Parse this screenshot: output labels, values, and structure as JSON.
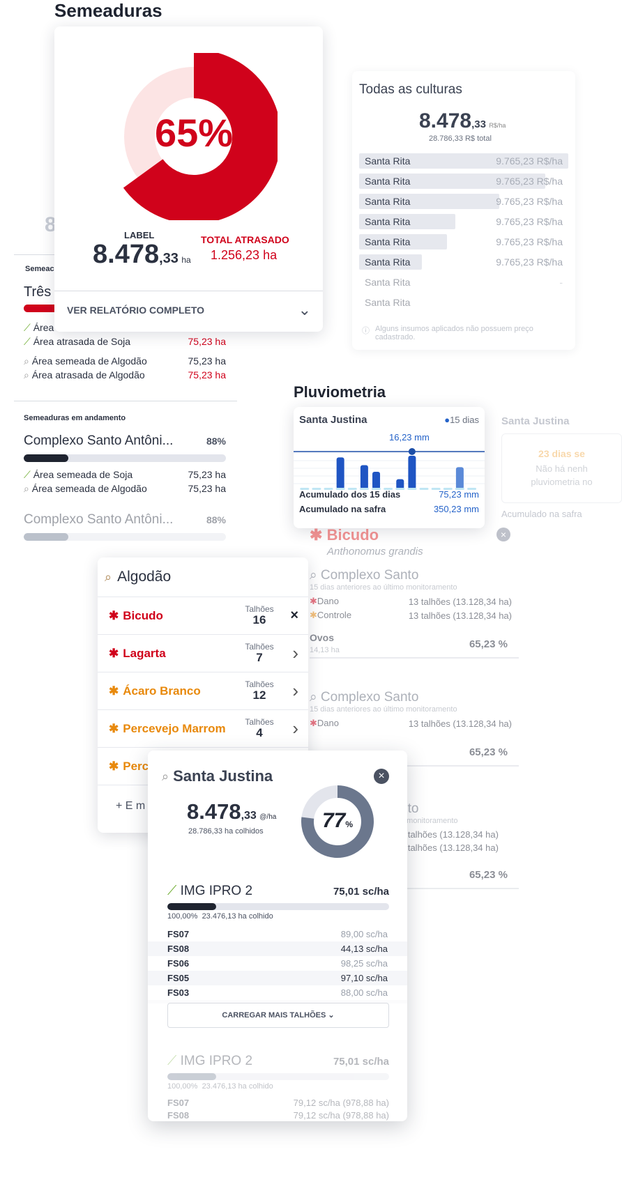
{
  "semeaduras": {
    "title": "Semeaduras",
    "percent": "65%",
    "percent_value": 65,
    "label": "LABEL",
    "value_main": "8.478",
    "value_dec": ",33",
    "value_unit": "ha",
    "atrasado_label": "TOTAL ATRASADO",
    "atrasado_value": "1.256,23 ha",
    "report_link": "VER RELATÓRIO COMPLETO",
    "bg_digit": "8",
    "bg_section": "Semeac",
    "bg_name": "Três",
    "rows": [
      {
        "label": "Área",
        "value": ""
      },
      {
        "label": "Área atrasada de Soja",
        "value": "75,23 ha"
      },
      {
        "label": "Área semeada de Algodão",
        "value": "75,23 ha"
      },
      {
        "label": "Área atrasada de Algodão",
        "value": "75,23 ha"
      }
    ],
    "andamento_title": "Semeaduras em andamento",
    "complex1_name": "Complexo Santo Antôni...",
    "complex1_pct": "88%",
    "complex1_progress": 0.22,
    "complex1_rows": [
      {
        "label": "Área semeada de Soja",
        "value": "75,23 ha"
      },
      {
        "label": "Área semeada de Algodão",
        "value": "75,23 ha"
      }
    ],
    "complex2_name": "Complexo Santo Antôni...",
    "complex2_pct": "88%",
    "complex2_progress": 0.22
  },
  "todas": {
    "title": "Todas as culturas",
    "value_main": "8.478",
    "value_dec": ",33",
    "value_unit": "R$/ha",
    "total": "28.786,33 R$ total",
    "bars": [
      {
        "name": "Santa Rita",
        "value": "9.765,23 R$/ha",
        "fill": 1.0
      },
      {
        "name": "Santa Rita",
        "value": "9.765,23 R$/ha",
        "fill": 0.89
      },
      {
        "name": "Santa Rita",
        "value": "9.765,23 R$/ha",
        "fill": 0.67
      },
      {
        "name": "Santa Rita",
        "value": "9.765,23 R$/ha",
        "fill": 0.46
      },
      {
        "name": "Santa Rita",
        "value": "9.765,23 R$/ha",
        "fill": 0.42
      },
      {
        "name": "Santa Rita",
        "value": "9.765,23 R$/ha",
        "fill": 0.3
      },
      {
        "name": "Santa Rita",
        "value": "-",
        "fill": 0.0
      },
      {
        "name": "Santa Rita",
        "value": "",
        "fill": 0.0
      }
    ],
    "note": "Alguns insumos aplicados não possuem preço cadastrado."
  },
  "pluvio": {
    "title": "Pluviometria",
    "station": "Santa Justina",
    "days": "15 dias",
    "line_label": "16,23 mm",
    "bars": [
      0,
      0,
      0,
      0.95,
      0,
      0.72,
      0.52,
      0,
      0.3,
      1.0,
      0,
      0,
      0,
      0.66,
      0
    ],
    "acum15_label": "Acumulado dos 15 dias",
    "acum15_value": "75,23 mm",
    "safra_label": "Acumulado na safra",
    "safra_value": "350,23 mm",
    "card2_station": "Santa Justina",
    "card2_alert": "23 dias se",
    "card2_text1": "Não há nenh",
    "card2_text2": "pluviometria no",
    "card2_acum": "Acumulado na safra"
  },
  "bicudo": {
    "name": "Bicudo",
    "sci": "Anthonomus grandis",
    "blocks": [
      {
        "title": "Complexo Santo",
        "sub": "15 dias anteriores ao último monitoramento",
        "dano": "Dano",
        "dano_val": "13 talhões (13.128,34 ha)",
        "controle": "Controle",
        "controle_val": "13 talhões (13.128,34 ha)",
        "metric": "Ovos",
        "metric_sub": "14,13 ha",
        "pct": "65,23 %"
      },
      {
        "title": "Complexo Santo",
        "sub": "15 dias anteriores ao último monitoramento",
        "dano": "Dano",
        "dano_val": "13 talhões (13.128,34 ha)",
        "pct": "65,23 %"
      },
      {
        "title": "nto",
        "sub": "o monitoramento",
        "val1": "3 talhões (13.128,34 ha)",
        "val2": "3 talhões (13.128,34 ha)",
        "pct": "65,23 %"
      }
    ]
  },
  "algodao": {
    "title": "Algodão",
    "talhoes_label": "Talhões",
    "items": [
      {
        "name": "Bicudo",
        "count": "16",
        "color": "#d0021b",
        "action": "×"
      },
      {
        "name": "Lagarta",
        "count": "7",
        "color": "#d0021b",
        "action": "›"
      },
      {
        "name": "Ácaro Branco",
        "count": "12",
        "color": "#e8890c",
        "action": "›"
      },
      {
        "name": "Percevejo Marrom",
        "count": "4",
        "color": "#e8890c",
        "action": "›"
      },
      {
        "name": "Perc",
        "count": "",
        "color": "#e8890c",
        "action": ""
      }
    ],
    "add_label": "+ E m"
  },
  "santa": {
    "title": "Santa Justina",
    "value_main": "8.478",
    "value_dec": ",33",
    "value_unit": "@/ha",
    "colhidos": "28.786,33 ha colhidos",
    "donut_pct": "77",
    "donut_sym": "%",
    "donut_value": 77,
    "variety1": "IMG IPRO 2",
    "variety1_value": "75,01 sc/ha",
    "variety1_progress": 0.22,
    "variety1_pct": "100,00%",
    "variety1_colhido": "23.476,13 ha colhido",
    "rows": [
      {
        "name": "FS07",
        "value": "89,00 sc/ha",
        "dark": false
      },
      {
        "name": "FS08",
        "value": "44,13 sc/ha",
        "dark": true
      },
      {
        "name": "FS06",
        "value": "98,25 sc/ha",
        "dark": false
      },
      {
        "name": "FS05",
        "value": "97,10 sc/ha",
        "dark": true
      },
      {
        "name": "FS03",
        "value": "88,00 sc/ha",
        "dark": false
      },
      {
        "name": "FS08",
        "value": "79,12 sc/ha",
        "dark": false
      }
    ],
    "load_more": "CARREGAR MAIS TALHÕES",
    "variety2": "IMG IPRO 2",
    "variety2_value": "75,01 sc/ha",
    "variety2_progress": 0.22,
    "variety2_pct": "100,00%",
    "variety2_colhido": "23.476,13 ha colhido",
    "rows2": [
      {
        "name": "FS07",
        "value": "79,12 sc/ha (978,88 ha)"
      },
      {
        "name": "FS08",
        "value": "79,12 sc/ha (978,88 ha)"
      }
    ]
  },
  "colors": {
    "red": "#d0021b",
    "orange": "#e8890c",
    "blue": "#2563c9",
    "dark": "#2b3140",
    "slate": "#6b778d"
  }
}
